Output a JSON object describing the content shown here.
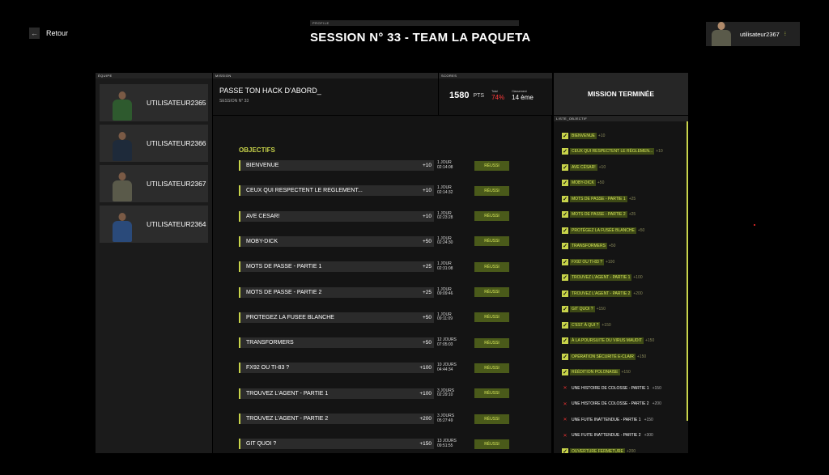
{
  "header": {
    "back_label": "Retour",
    "profile_tag": "PROFILE",
    "title": "SESSION N° 33 - TEAM LA PAQUETA"
  },
  "user": {
    "name": "utilisateur2367",
    "menu_icon": "menu-dots-icon"
  },
  "team": {
    "tag": "ÉQUIPE",
    "members": [
      {
        "name": "UTILISATEUR2365",
        "outfit": "#2e5a2e"
      },
      {
        "name": "UTILISATEUR2366",
        "outfit": "#1e2a3a"
      },
      {
        "name": "UTILISATEUR2367",
        "outfit": "#5a5a4a"
      },
      {
        "name": "UTILISATEUR2364",
        "outfit": "#2a4a7a"
      }
    ]
  },
  "mission": {
    "tag": "MISSION",
    "name": "PASSE TON HACK D'ABORD_",
    "session_label": "SESSION N°",
    "session_number": "33"
  },
  "scores": {
    "tag": "SCORES",
    "points": "1580",
    "points_unit": "PTS",
    "total_label": "Total",
    "total_value": "74%",
    "rank_label": "Classement",
    "rank_value": "14 ème"
  },
  "status": {
    "label": "MISSION TERMINÉE"
  },
  "objectives": {
    "title": "OBJECTIFS",
    "items": [
      {
        "name": "BIENVENUE",
        "points": "+10",
        "time1": "1 JOUR",
        "time2": "02:14:08",
        "status": "RÉUSSI"
      },
      {
        "name": "CEUX QUI RESPECTENT LE REGLEMENT...",
        "points": "+10",
        "time1": "1 JOUR",
        "time2": "02:14:32",
        "status": "RÉUSSI"
      },
      {
        "name": "AVE CESAR!",
        "points": "+10",
        "time1": "1 JOUR",
        "time2": "02:23:28",
        "status": "RÉUSSI"
      },
      {
        "name": "MOBY-DICK",
        "points": "+50",
        "time1": "1 JOUR",
        "time2": "02:24:30",
        "status": "RÉUSSI"
      },
      {
        "name": "MOTS DE PASSE - PARTIE 1",
        "points": "+25",
        "time1": "1 JOUR",
        "time2": "02:31:08",
        "status": "RÉUSSI"
      },
      {
        "name": "MOTS DE PASSE - PARTIE 2",
        "points": "+25",
        "time1": "1 JOUR",
        "time2": "09:09:46",
        "status": "RÉUSSI"
      },
      {
        "name": "PROTEGEZ LA FUSEE BLANCHE",
        "points": "+50",
        "time1": "1 JOUR",
        "time2": "09:11:09",
        "status": "RÉUSSI"
      },
      {
        "name": "TRANSFORMERS",
        "points": "+50",
        "time1": "12 JOURS",
        "time2": "07:05:03",
        "status": "RÉUSSI"
      },
      {
        "name": "FX92 OU TI-83 ?",
        "points": "+100",
        "time1": "10 JOURS",
        "time2": "04:44:34",
        "status": "RÉUSSI"
      },
      {
        "name": "TROUVEZ L'AGENT - PARTIE 1",
        "points": "+100",
        "time1": "3 JOURS",
        "time2": "02:29:10",
        "status": "RÉUSSI"
      },
      {
        "name": "TROUVEZ L'AGENT - PARTIE 2",
        "points": "+200",
        "time1": "3 JOURS",
        "time2": "05:27:49",
        "status": "RÉUSSI"
      },
      {
        "name": "GIT QUOI ?",
        "points": "+150",
        "time1": "13 JOURS",
        "time2": "09:51:55",
        "status": "RÉUSSI"
      }
    ]
  },
  "objective_list": {
    "tag": "LISTE_OBJECTIF",
    "items": [
      {
        "name": "BIENVENUE",
        "points": "+10",
        "done": true
      },
      {
        "name": "CEUX QUI RESPECTENT LE RÈGLEMEN...",
        "points": "+10",
        "done": true
      },
      {
        "name": "AVE CÉSAR!",
        "points": "+10",
        "done": true
      },
      {
        "name": "MOBY-DICK",
        "points": "+50",
        "done": true
      },
      {
        "name": "MOTS DE PASSE - PARTIE 1",
        "points": "+25",
        "done": true
      },
      {
        "name": "MOTS DE PASSE - PARTIE 2",
        "points": "+25",
        "done": true
      },
      {
        "name": "PROTÉGEZ LA FUSÉE BLANCHE",
        "points": "+50",
        "done": true
      },
      {
        "name": "TRANSFORMERS",
        "points": "+50",
        "done": true
      },
      {
        "name": "FX92 OU TI-83 ?",
        "points": "+100",
        "done": true
      },
      {
        "name": "TROUVEZ L'AGENT - PARTIE 1",
        "points": "+100",
        "done": true
      },
      {
        "name": "TROUVEZ L'AGENT - PARTIE 2",
        "points": "+200",
        "done": true
      },
      {
        "name": "GIT QUOI ?",
        "points": "+150",
        "done": true
      },
      {
        "name": "C'EST À QUI ?",
        "points": "+150",
        "done": true
      },
      {
        "name": "À LA POURSUITE DU VIRUS MAUDIT",
        "points": "+150",
        "done": true
      },
      {
        "name": "OPÉRATION SÉCURITÉ E-CLAIR",
        "points": "+150",
        "done": true
      },
      {
        "name": "RÉÉDITION POLONAISE",
        "points": "+150",
        "done": true
      },
      {
        "name": "UNE HISTOIRE DE COLOSSE - PARTIE 1",
        "points": "+150",
        "done": false
      },
      {
        "name": "UNE HISTOIRE DE COLOSSE - PARTIE 2",
        "points": "+200",
        "done": false
      },
      {
        "name": "UNE FUITE INATTENDUE - PARTIE 1",
        "points": "+150",
        "done": false
      },
      {
        "name": "UNE FUITE INATTENDUE - PARTIE 2",
        "points": "+300",
        "done": false
      },
      {
        "name": "OUVERTURE FERMETURE",
        "points": "+200",
        "done": true
      }
    ]
  },
  "colors": {
    "accent": "#c8d44a",
    "success_bg": "#4a5a1a",
    "fail": "#e03030",
    "rate": "#ff3a3a"
  }
}
